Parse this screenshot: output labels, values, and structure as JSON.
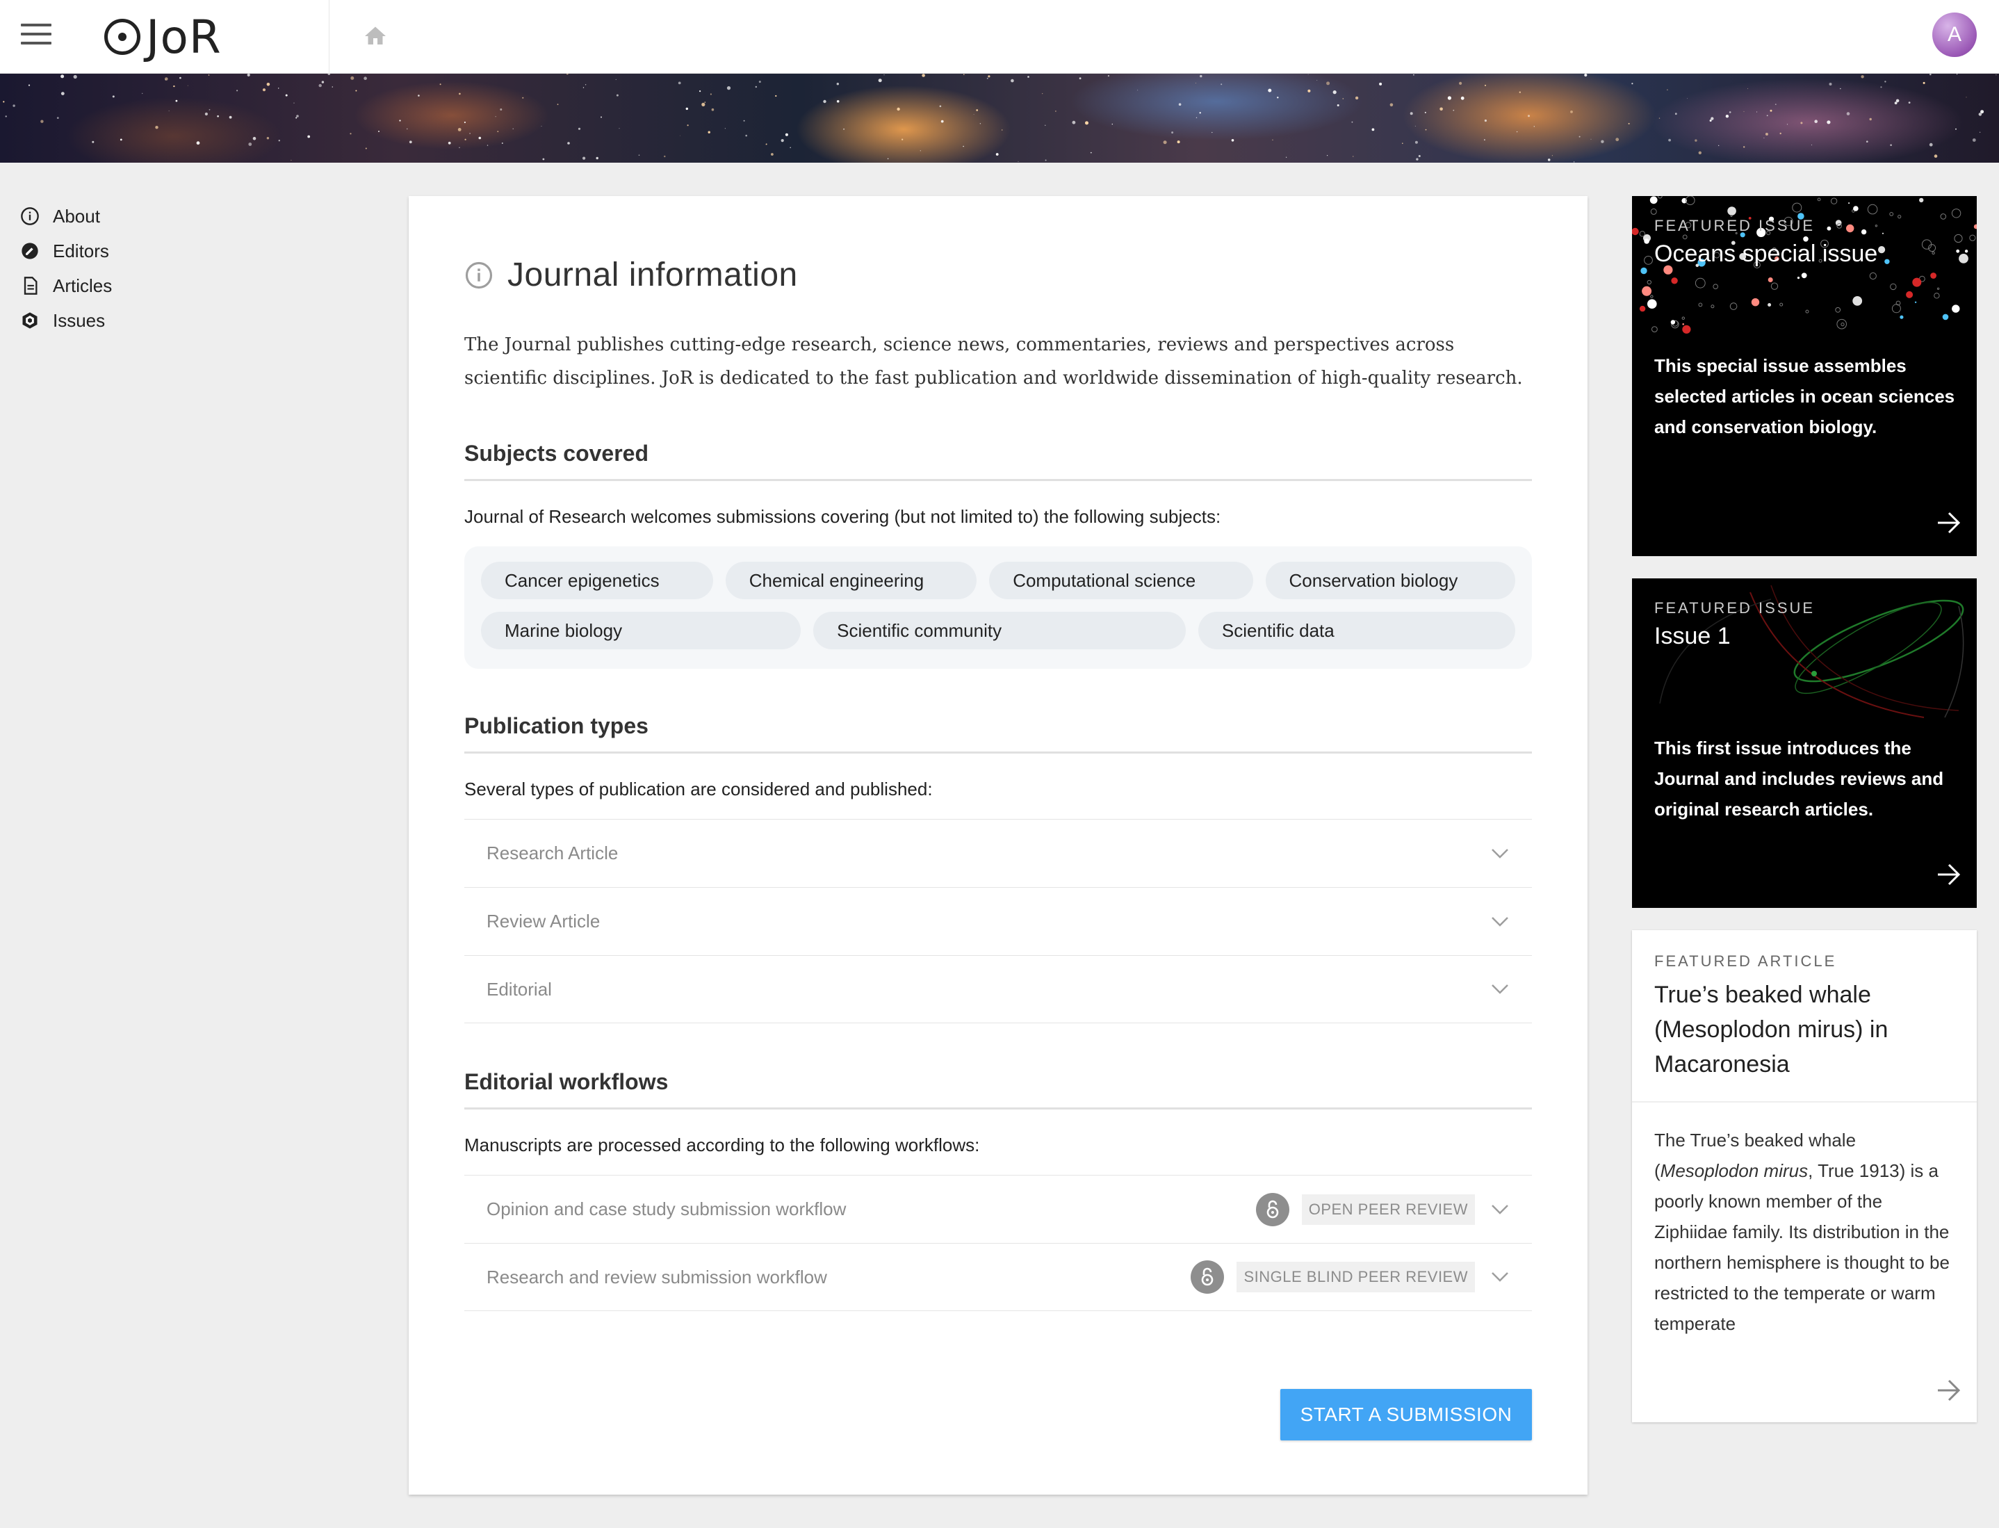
{
  "header": {
    "logo_text": "JoR",
    "avatar_initial": "A"
  },
  "sidebar": {
    "items": [
      {
        "label": "About",
        "icon": "info-icon"
      },
      {
        "label": "Editors",
        "icon": "editors-icon"
      },
      {
        "label": "Articles",
        "icon": "article-icon"
      },
      {
        "label": "Issues",
        "icon": "issues-icon"
      }
    ]
  },
  "main": {
    "title": "Journal information",
    "intro": "The Journal publishes cutting-edge research, science news, commentaries, reviews and perspectives across scientific disciplines. JoR is dedicated to the fast publication and worldwide dissemination of high-quality research.",
    "subjects": {
      "title": "Subjects covered",
      "description": "Journal of Research welcomes submissions covering (but not limited to) the following subjects:",
      "chips": [
        "Cancer epigenetics",
        "Chemical engineering",
        "Computational science",
        "Conservation biology",
        "Marine biology",
        "Scientific community",
        "Scientific data"
      ]
    },
    "publication_types": {
      "title": "Publication types",
      "description": "Several types of publication are considered and published:",
      "items": [
        "Research Article",
        "Review Article",
        "Editorial"
      ]
    },
    "workflows": {
      "title": "Editorial workflows",
      "description": "Manuscripts are processed according to the following workflows:",
      "items": [
        {
          "label": "Opinion and case study submission workflow",
          "badge": "OPEN PEER REVIEW"
        },
        {
          "label": "Research and review submission workflow",
          "badge": "SINGLE BLIND PEER REVIEW"
        }
      ]
    },
    "submit_label": "START A SUBMISSION"
  },
  "featured": [
    {
      "kicker": "FEATURED ISSUE",
      "title": "Oceans special issue",
      "description": "This special issue assembles selected articles in ocean sciences and conservation biology."
    },
    {
      "kicker": "FEATURED ISSUE",
      "title": "Issue 1",
      "description": "This first issue introduces the Journal and includes reviews and original research articles."
    },
    {
      "kicker": "FEATURED ARTICLE",
      "title": "True’s beaked whale (Mesoplodon mirus) in Macaronesia",
      "description_pre": "The True’s beaked whale (",
      "description_italic": "Mesoplodon mirus",
      "description_post": ", True 1913) is a poorly known member of the Ziphiidae family. Its distribution in the northern hemisphere is thought to be restricted to the temperate or warm temperate"
    }
  ],
  "colors": {
    "accent": "#42a5f5",
    "background": "#eeeeee"
  }
}
